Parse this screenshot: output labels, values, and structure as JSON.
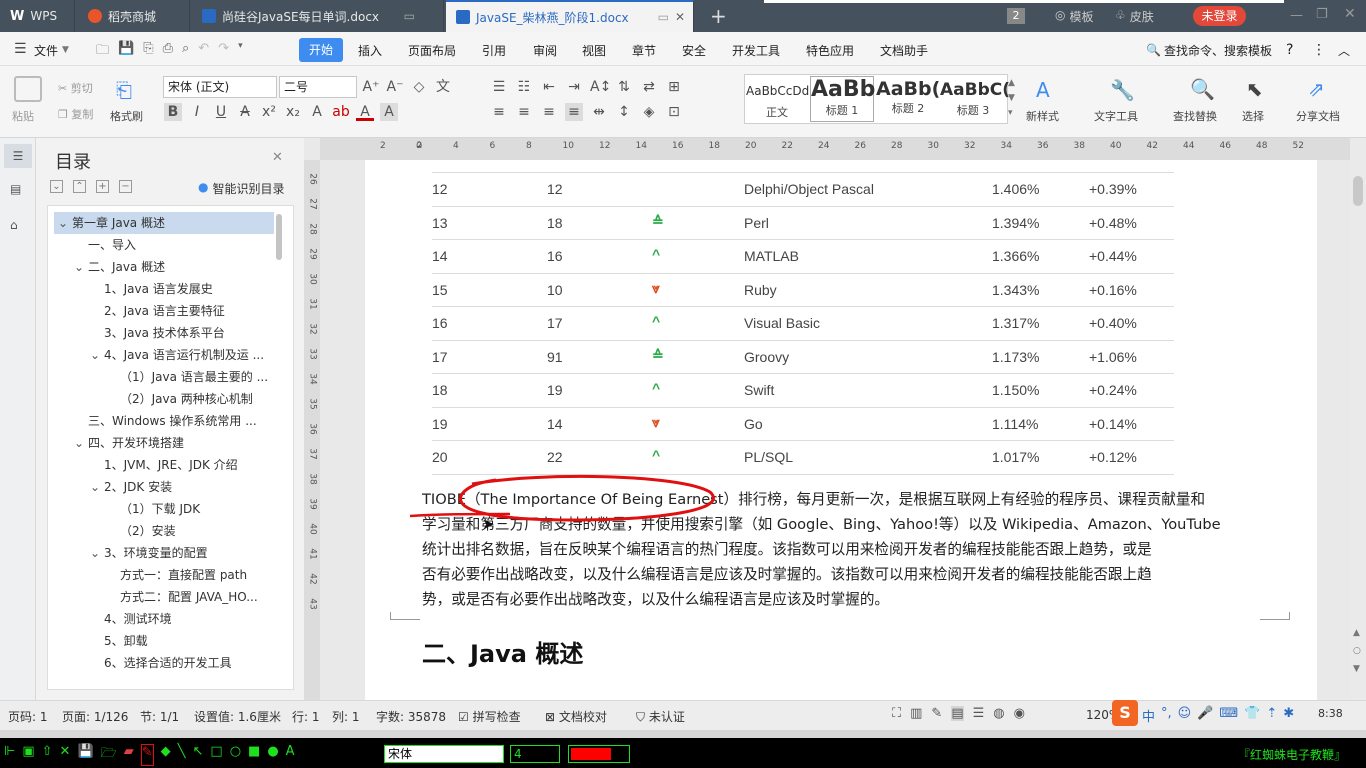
{
  "tabs": [
    {
      "label": "WPS",
      "color": "#ffffff"
    },
    {
      "label": "稻壳商城",
      "color": "#e8552a"
    },
    {
      "label": "尚硅谷JavaSE每日单词.docx",
      "color": "#2b6ac2"
    },
    {
      "label": "JavaSE_柴林燕_阶段1.docx",
      "color": "#2b6ac2"
    }
  ],
  "titlebar": {
    "add_tab": "+",
    "badge": "2",
    "template": "模板",
    "skin": "皮肤",
    "login": "未登录"
  },
  "menu": {
    "file": "文件",
    "items": [
      "开始",
      "插入",
      "页面布局",
      "引用",
      "审阅",
      "视图",
      "章节",
      "安全",
      "开发工具",
      "特色应用",
      "文档助手"
    ],
    "active_index": 0,
    "search": "查找命令、搜索模板"
  },
  "ribbon": {
    "paste": "粘贴",
    "cut": "剪切",
    "copy": "复制",
    "format_painter": "格式刷",
    "font_name": "宋体 (正文)",
    "font_size": "二号",
    "styles": [
      {
        "preview": "AaBbCcDd",
        "label": "正文"
      },
      {
        "preview": "AaBb",
        "label": "标题 1"
      },
      {
        "preview": "AaBb(",
        "label": "标题 2"
      },
      {
        "preview": "AaBbC(",
        "label": "标题 3"
      }
    ],
    "new_style": "新样式",
    "text_tools": "文字工具",
    "find_replace": "查找替换",
    "select": "选择",
    "share": "分享文档"
  },
  "toc": {
    "title": "目录",
    "smart": "智能识别目录",
    "items": [
      {
        "label": "第一章 Java 概述",
        "level": 0,
        "arrow": "⌄",
        "selected": true
      },
      {
        "label": "一、导入",
        "level": 1,
        "arrow": ""
      },
      {
        "label": "二、Java 概述",
        "level": 1,
        "arrow": "⌄"
      },
      {
        "label": "1、Java 语言发展史",
        "level": 2,
        "arrow": ""
      },
      {
        "label": "2、Java 语言主要特征",
        "level": 2,
        "arrow": ""
      },
      {
        "label": "3、Java 技术体系平台",
        "level": 2,
        "arrow": ""
      },
      {
        "label": "4、Java 语言运行机制及运 ...",
        "level": 2,
        "arrow": "⌄"
      },
      {
        "label": "（1）Java 语言最主要的 ...",
        "level": 3,
        "arrow": ""
      },
      {
        "label": "（2）Java 两种核心机制",
        "level": 3,
        "arrow": ""
      },
      {
        "label": "三、Windows 操作系统常用 ...",
        "level": 1,
        "arrow": ""
      },
      {
        "label": "四、开发环境搭建",
        "level": 1,
        "arrow": "⌄"
      },
      {
        "label": "1、JVM、JRE、JDK 介绍",
        "level": 2,
        "arrow": ""
      },
      {
        "label": "2、JDK 安装",
        "level": 2,
        "arrow": "⌄"
      },
      {
        "label": "（1）下载 JDK",
        "level": 3,
        "arrow": ""
      },
      {
        "label": "（2）安装",
        "level": 3,
        "arrow": ""
      },
      {
        "label": "3、环境变量的配置",
        "level": 2,
        "arrow": "⌄"
      },
      {
        "label": "方式一：直接配置 path",
        "level": 3,
        "arrow": ""
      },
      {
        "label": "方式二：配置 JAVA_HO...",
        "level": 3,
        "arrow": ""
      },
      {
        "label": "4、测试环境",
        "level": 2,
        "arrow": ""
      },
      {
        "label": "5、卸载",
        "level": 2,
        "arrow": ""
      },
      {
        "label": "6、选择合适的开发工具",
        "level": 2,
        "arrow": ""
      }
    ]
  },
  "ruler": {
    "h_ticks": [
      "2",
      "2",
      "4",
      "6",
      "8",
      "10",
      "12",
      "14",
      "16",
      "18",
      "20",
      "22",
      "24",
      "26",
      "28",
      "30",
      "32",
      "34",
      "36",
      "38",
      "40",
      "42",
      "44",
      "46",
      "48",
      "52"
    ],
    "v_ticks": [
      "26",
      "27",
      "28",
      "29",
      "30",
      "31",
      "32",
      "33",
      "34",
      "35",
      "36",
      "37",
      "38",
      "39",
      "40",
      "41",
      "42",
      "43"
    ]
  },
  "table": [
    {
      "rank": "12",
      "prev": "12",
      "trend": "",
      "lang": "Delphi/Object Pascal",
      "rating": "1.406%",
      "change": "+0.39%"
    },
    {
      "rank": "13",
      "prev": "18",
      "trend": "double-up",
      "lang": "Perl",
      "rating": "1.394%",
      "change": "+0.48%"
    },
    {
      "rank": "14",
      "prev": "16",
      "trend": "up",
      "lang": "MATLAB",
      "rating": "1.366%",
      "change": "+0.44%"
    },
    {
      "rank": "15",
      "prev": "10",
      "trend": "double-down",
      "lang": "Ruby",
      "rating": "1.343%",
      "change": "+0.16%"
    },
    {
      "rank": "16",
      "prev": "17",
      "trend": "up",
      "lang": "Visual Basic",
      "rating": "1.317%",
      "change": "+0.40%"
    },
    {
      "rank": "17",
      "prev": "91",
      "trend": "double-up",
      "lang": "Groovy",
      "rating": "1.173%",
      "change": "+1.06%"
    },
    {
      "rank": "18",
      "prev": "19",
      "trend": "up",
      "lang": "Swift",
      "rating": "1.150%",
      "change": "+0.24%"
    },
    {
      "rank": "19",
      "prev": "14",
      "trend": "double-down",
      "lang": "Go",
      "rating": "1.114%",
      "change": "+0.14%"
    },
    {
      "rank": "20",
      "prev": "22",
      "trend": "up",
      "lang": "PL/SQL",
      "rating": "1.017%",
      "change": "+0.12%"
    }
  ],
  "document": {
    "para_lines": [
      "TIOBE（The Importance Of Being Earnest）排行榜，每月更新一次，是根据互联网上有经验的程序员、课程贡献量和",
      "学习量和第三方厂商支持的数量，并使用搜索引擎（如 Google、Bing、Yahoo!等）以及 Wikipedia、Amazon、YouTube",
      "统计出排名数据，旨在反映某个编程语言的热门程度。该指数可以用来检阅开发者的编程技能能否跟上趋势，或是",
      "否有必要作出战略改变，以及什么编程语言是应该及时掌握的。该指数可以用来检阅开发者的编程技能能否跟上趋",
      "势，或是否有必要作出战略改变，以及什么编程语言是应该及时掌握的。"
    ],
    "heading": "二、Java 概述"
  },
  "status": {
    "page_num": "页码: 1",
    "pages": "页面: 1/126",
    "section": "节: 1/1",
    "setting": "设置值: 1.6厘米",
    "row": "行: 1",
    "col": "列: 1",
    "words": "字数: 35878",
    "spell": "拼写检查",
    "proof": "文档校对",
    "cert": "未认证",
    "zoom": "120%",
    "time": "8:38"
  },
  "pen_toolbar": {
    "font": "宋体",
    "size": "4",
    "brand": "『红蜘蛛电子教鞭』",
    "pen_color": "#ff0000"
  },
  "colors": {
    "accent": "#2b6ac2",
    "annotation": "#e01010",
    "up": "#2eaa4a",
    "down": "#e04a1c",
    "taskbar_green": "#1ee01e"
  }
}
